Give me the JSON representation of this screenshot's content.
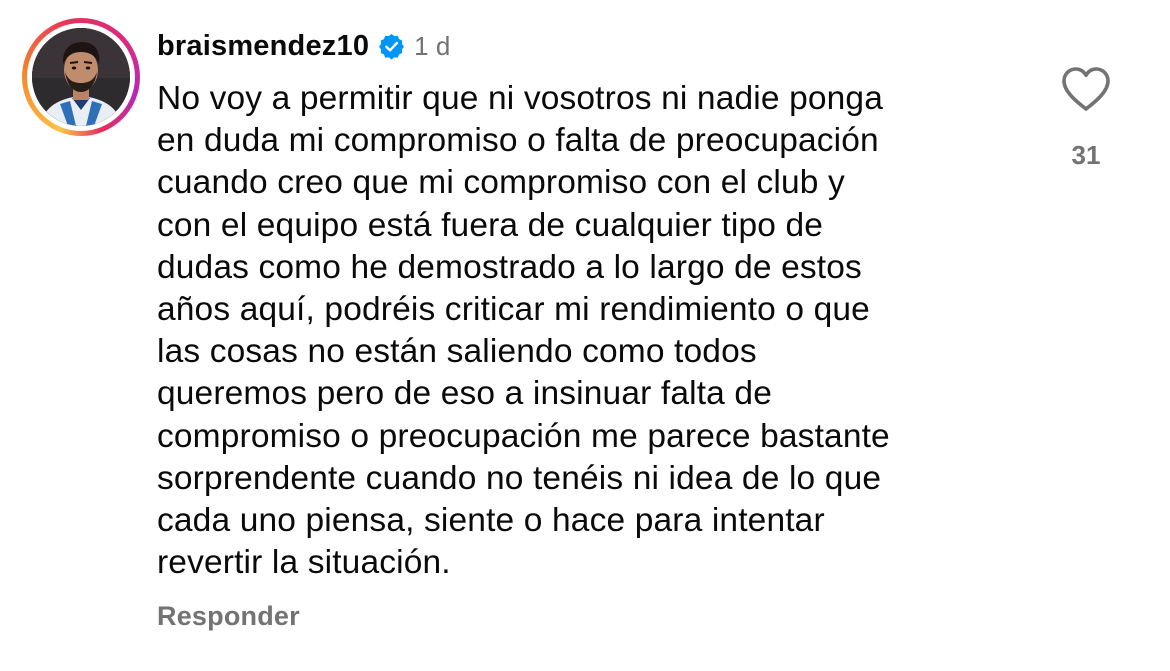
{
  "comment": {
    "username": "braismendez10",
    "verified": true,
    "time": "1 d",
    "text_lines": [
      "No voy a permitir que ni vosotros ni nadie ponga",
      "en duda mi compromiso o falta de preocupación",
      "cuando creo que mi compromiso con el club y",
      "con el equipo está fuera de cualquier tipo de",
      "dudas como he demostrado a lo largo de estos",
      "años aquí, podréis criticar mi rendimiento o que",
      "las cosas no están saliendo como todos",
      "queremos pero de eso a insinuar falta de",
      "compromiso o preocupación me parece bastante",
      "sorprendente cuando no tenéis ni idea de lo que",
      "cada uno piensa, siente o hace para intentar",
      "revertir la situación."
    ],
    "reply_label": "Responder",
    "like_count": "31",
    "icons": {
      "like": "heart-outline-icon",
      "verified": "verified-badge-icon"
    }
  },
  "colors": {
    "text_primary": "#0a0a0a",
    "text_secondary": "#737373",
    "verified_blue": "#0095f6",
    "background": "#ffffff"
  }
}
